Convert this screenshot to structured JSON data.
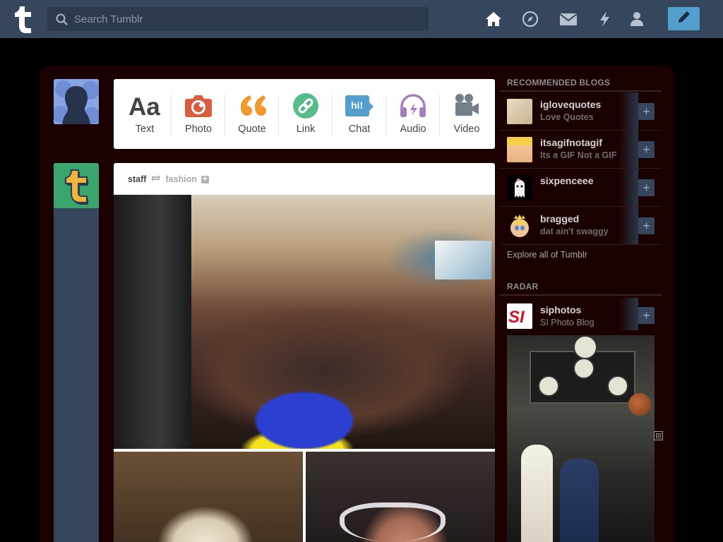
{
  "header": {
    "logo_letter": "t",
    "search": {
      "placeholder": "Search Tumblr"
    },
    "nav_icons": [
      "home-icon",
      "explore-compass-icon",
      "inbox-envelope-icon",
      "activity-lightning-icon",
      "account-person-icon"
    ],
    "compose_icon": "pencil-icon",
    "accent_color": "#529ecc",
    "bar_color": "#36465d"
  },
  "post_types": [
    {
      "label": "Text",
      "icon": "text-aa-icon"
    },
    {
      "label": "Photo",
      "icon": "camera-icon"
    },
    {
      "label": "Quote",
      "icon": "quote-icon"
    },
    {
      "label": "Link",
      "icon": "link-icon"
    },
    {
      "label": "Chat",
      "icon": "chat-bubble-icon",
      "badge": "hi!"
    },
    {
      "label": "Audio",
      "icon": "headphones-icon"
    },
    {
      "label": "Video",
      "icon": "video-camera-icon"
    }
  ],
  "post": {
    "author": "staff",
    "reblogged_from": "fashion"
  },
  "sidebar": {
    "recommended_title": "RECOMMENDED BLOGS",
    "recommended": [
      {
        "name": "iglovequotes",
        "subtitle": "Love Quotes"
      },
      {
        "name": "itsagifnotagif",
        "subtitle": "Its a GIF Not a GIF"
      },
      {
        "name": "sixpenceee",
        "subtitle": ""
      },
      {
        "name": "bragged",
        "subtitle": "dat ain't swaggy"
      }
    ],
    "explore_link": "Explore all of Tumblr",
    "radar_title": "RADAR",
    "radar": {
      "name": "siphotos",
      "subtitle": "SI Photo Blog",
      "logo_text": "SI"
    }
  }
}
